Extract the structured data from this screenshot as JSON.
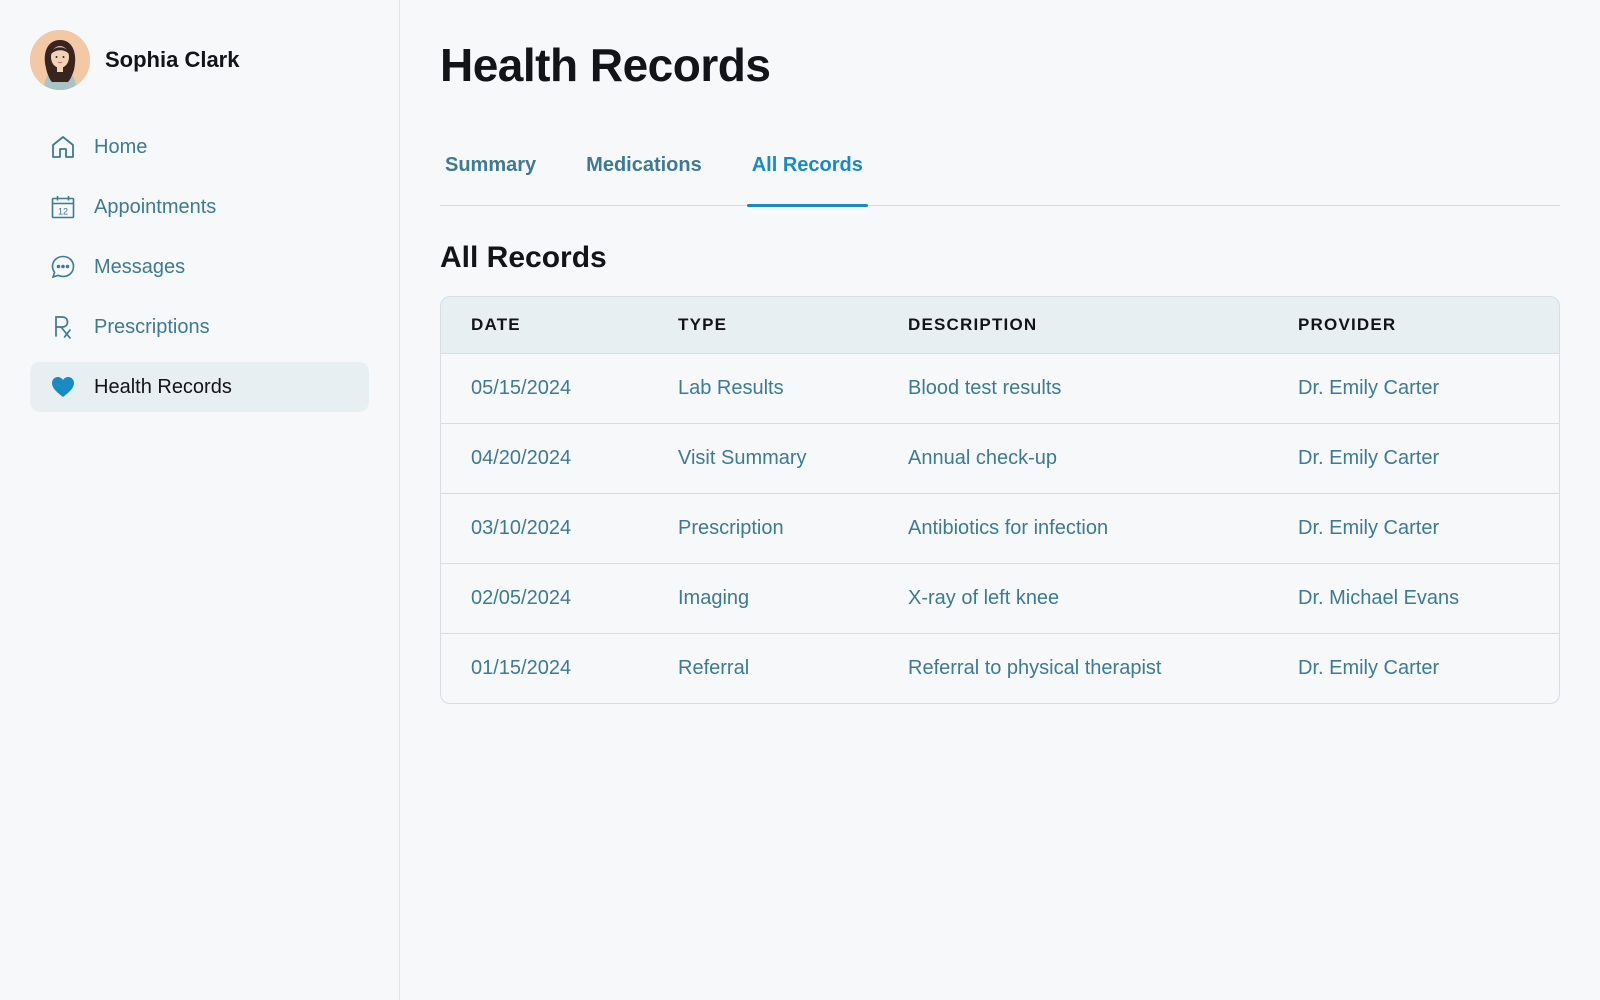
{
  "user": {
    "name": "Sophia Clark",
    "avatar_icon": "user-avatar"
  },
  "sidebar": {
    "items": [
      {
        "label": "Home",
        "icon": "home-icon",
        "active": false
      },
      {
        "label": "Appointments",
        "icon": "calendar-icon",
        "active": false
      },
      {
        "label": "Messages",
        "icon": "chat-icon",
        "active": false
      },
      {
        "label": "Prescriptions",
        "icon": "rx-icon",
        "active": false
      },
      {
        "label": "Health Records",
        "icon": "heart-icon",
        "active": true
      }
    ],
    "calendar_day": "12"
  },
  "page": {
    "title": "Health Records"
  },
  "tabs": [
    {
      "label": "Summary",
      "active": false
    },
    {
      "label": "Medications",
      "active": false
    },
    {
      "label": "All Records",
      "active": true
    }
  ],
  "section": {
    "title": "All Records"
  },
  "table": {
    "headers": [
      "DATE",
      "TYPE",
      "DESCRIPTION",
      "PROVIDER"
    ],
    "rows": [
      [
        "05/15/2024",
        "Lab Results",
        "Blood test results",
        "Dr. Emily Carter"
      ],
      [
        "04/20/2024",
        "Visit Summary",
        "Annual check-up",
        "Dr. Emily Carter"
      ],
      [
        "03/10/2024",
        "Prescription",
        "Antibiotics for infection",
        "Dr. Emily Carter"
      ],
      [
        "02/05/2024",
        "Imaging",
        "X-ray of left knee",
        "Dr. Michael Evans"
      ],
      [
        "01/15/2024",
        "Referral",
        "Referral to physical therapist",
        "Dr. Emily Carter"
      ]
    ]
  },
  "colors": {
    "accent": "#1a8ac6",
    "muted_text": "#3e7a93",
    "active_bg": "#e8eff3",
    "background": "#f6f8fa"
  }
}
